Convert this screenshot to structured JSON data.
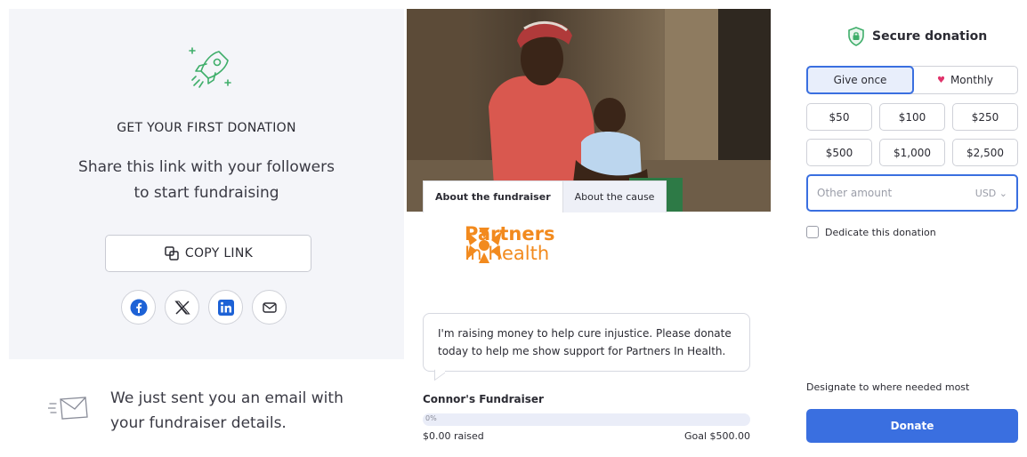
{
  "share_panel": {
    "heading": "GET YOUR FIRST DONATION",
    "subtitle_line1": "Share this link with your followers",
    "subtitle_line2": "to start fundraising",
    "copy_link_label": "COPY LINK",
    "socials": [
      "facebook-icon",
      "x-icon",
      "linkedin-icon",
      "mail-icon"
    ],
    "email_line1": "We just sent you an email with",
    "email_line2": "your fundraiser details."
  },
  "fundraiser": {
    "tabs": [
      {
        "label": "About the fundraiser",
        "active": true
      },
      {
        "label": "About the cause",
        "active": false
      }
    ],
    "org_name_line1": "Partners",
    "org_name_line2": "In Health",
    "message": "I'm raising money to help cure injustice. Please donate today to help me show support for Partners In Health.",
    "title": "Connor's Fundraiser",
    "progress_percent": "0%",
    "progress_fraction": 0,
    "raised": "$0.00 raised",
    "goal": "Goal $500.00"
  },
  "donation": {
    "title": "Secure donation",
    "frequency": [
      {
        "label": "Give once",
        "active": true
      },
      {
        "label": "Monthly",
        "active": false
      }
    ],
    "amounts": [
      "$50",
      "$100",
      "$250",
      "$500",
      "$1,000",
      "$2,500"
    ],
    "other_placeholder": "Other amount",
    "currency": "USD",
    "dedicate_label": "Dedicate this donation",
    "designate_text": "Designate to where needed most",
    "donate_label": "Donate"
  },
  "colors": {
    "accent": "#3a6fe0",
    "brand_orange": "#f28a1e",
    "rocket_green": "#3fae6a",
    "heart": "#e0336b"
  }
}
